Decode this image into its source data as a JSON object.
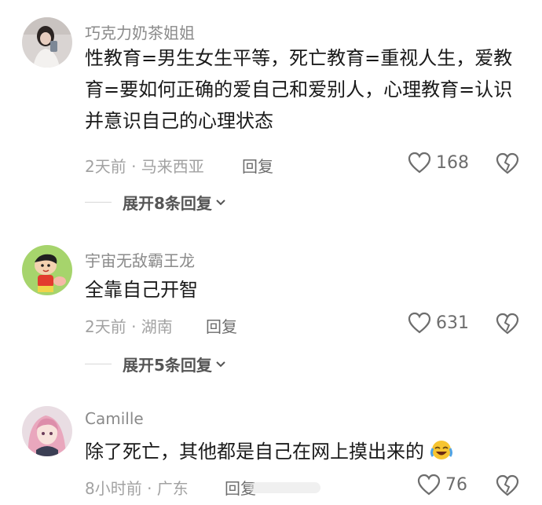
{
  "comments": [
    {
      "username": "巧克力奶茶姐姐",
      "text": "性教育=男生女生平等，死亡教育=重视人生，爱教育=要如何正确的爱自己和爱别人，心理教育=认识并意识自己的心理状态",
      "meta": "2天前 · 马来西亚",
      "reply_label": "回复",
      "likes": "168",
      "expand_label": "展开8条回复",
      "avatar_icon": "avatar-girl-photo-icon"
    },
    {
      "username": "宇宙无敌霸王龙",
      "text": "全靠自己开智",
      "meta": "2天前 · 湖南",
      "reply_label": "回复",
      "likes": "631",
      "expand_label": "展开5条回复",
      "avatar_icon": "avatar-cartoon-boy-icon"
    },
    {
      "username": "Camille",
      "text": "除了死亡，其他都是自己在网上摸出来的",
      "emoji": "crying-laughing-emoji",
      "meta": "8小时前 · 广东",
      "reply_label": "回复",
      "likes": "76",
      "avatar_icon": "avatar-anime-girl-icon"
    }
  ]
}
